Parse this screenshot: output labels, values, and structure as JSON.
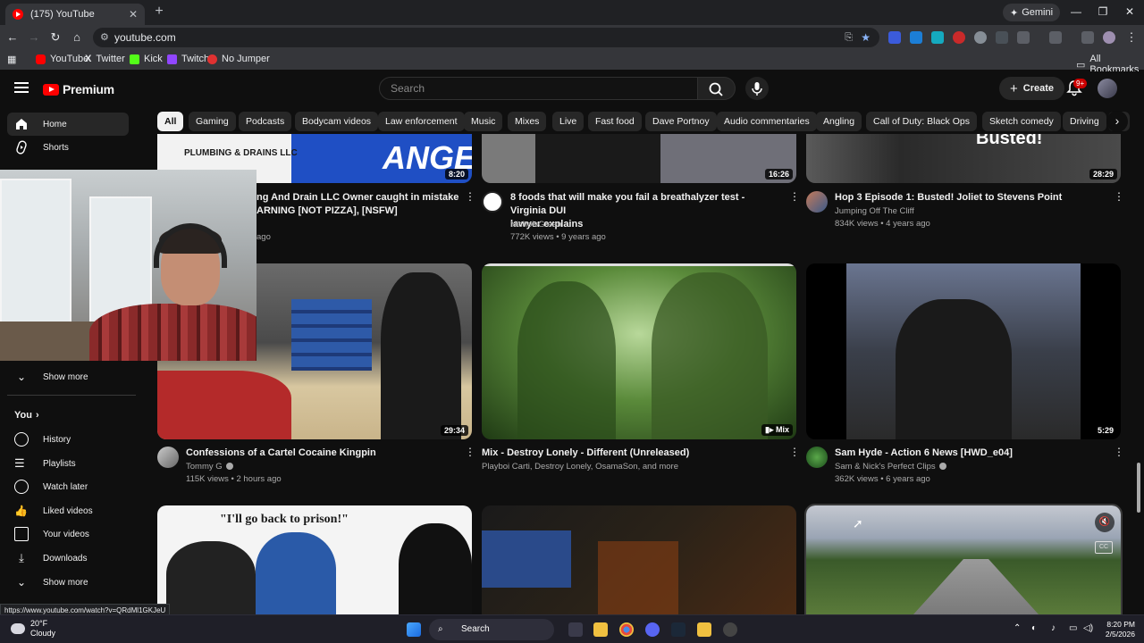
{
  "browser": {
    "tab_title": "(175) YouTube",
    "gemini_label": "Gemini",
    "url": "youtube.com",
    "bookmarks": [
      "YouTube",
      "Twitter",
      "Kick",
      "Twitch",
      "No Jumper"
    ],
    "all_bookmarks": "All Bookmarks",
    "status_url": "https://www.youtube.com/watch?v=QRdMl1GKJeU"
  },
  "youtube": {
    "logo_text": "Premium",
    "search_placeholder": "Search",
    "create_label": "Create",
    "notif_count": "9+",
    "chips": [
      "All",
      "Gaming",
      "Podcasts",
      "Bodycam videos",
      "Law enforcement",
      "Music",
      "Mixes",
      "Live",
      "Fast food",
      "Dave Portnoy",
      "Audio commentaries",
      "Angling",
      "Call of Duty: Black Ops",
      "Sketch comedy",
      "Driving",
      "C"
    ]
  },
  "sidebar": {
    "home": "Home",
    "shorts": "Shorts",
    "show_more_1": "Show more",
    "you": "You",
    "you_chevron": "›",
    "items": [
      "History",
      "Playlists",
      "Watch later",
      "Liked videos",
      "Your videos",
      "Downloads"
    ],
    "show_more_2": "Show more"
  },
  "videos": {
    "row1": [
      {
        "title_line1": "ng And Drain LLC Owner caught in mistake",
        "title_line2": "ARNING [NOT PIZZA], [NSFW]",
        "meta": "ago",
        "duration": "8:20",
        "thumb_text_1": "PLUMBING & DRAINS LLC",
        "thumb_text_2": "ANGER"
      },
      {
        "title_line1": "8 foods that will make you fail a breathalyzer test - Virginia DUI",
        "title_line2": "lawyer explains",
        "channel": "NicholsGreen",
        "meta": "772K views • 9 years ago",
        "duration": "16:26"
      },
      {
        "title_line1": "Hop 3 Episode 1: Busted! Joliet to Stevens Point",
        "channel": "Jumping Off The Cliff",
        "meta": "834K views • 4 years ago",
        "duration": "28:29",
        "thumb_text": "Busted!"
      }
    ],
    "row2": [
      {
        "title": "Confessions of a Cartel Cocaine Kingpin",
        "channel": "Tommy G",
        "meta": "115K views • 2 hours ago",
        "duration": "29:34"
      },
      {
        "title": "Mix - Destroy Lonely - Different (Unreleased)",
        "channel": "Playboi Carti, Destroy Lonely, OsamaSon, and more",
        "badge": "Mix"
      },
      {
        "title": "Sam Hyde - Action 6 News [HWD_e04]",
        "channel": "Sam & Nick's Perfect Clips",
        "meta": "362K views • 6 years ago",
        "duration": "5:29"
      }
    ],
    "row3": [
      {
        "thumb_text": "\"I'll go back to prison!\""
      },
      {},
      {}
    ]
  },
  "taskbar": {
    "temp": "20°F",
    "condition": "Cloudy",
    "search": "Search",
    "time": "8:20 PM",
    "date": "2/5/2026"
  },
  "colors": {
    "youtube_red": "#ff0000",
    "bg": "#0f0f0f",
    "chip_bg": "#272727"
  }
}
